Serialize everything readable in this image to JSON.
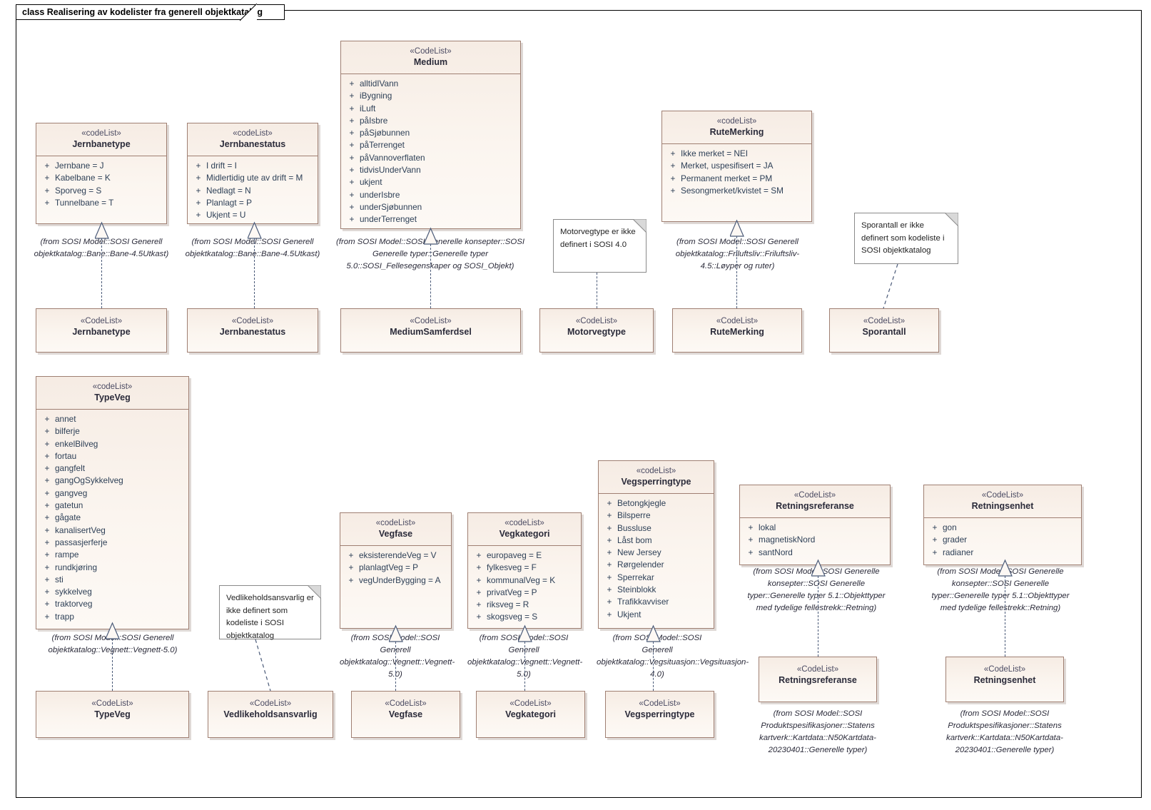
{
  "diagram": {
    "tab_label": "class Realisering av kodelister fra generell objektkatalog",
    "stereotype_codelist_lower": "«codeList»",
    "stereotype_codelist_upper": "«CodeList»"
  },
  "source_classes": {
    "jernbanetype": {
      "stereotype": "«codeList»",
      "name": "Jernbanetype",
      "attributes": [
        {
          "vis": "+",
          "text": "Jernbane = J"
        },
        {
          "vis": "+",
          "text": "Kabelbane = K"
        },
        {
          "vis": "+",
          "text": "Sporveg = S"
        },
        {
          "vis": "+",
          "text": "Tunnelbane = T"
        }
      ],
      "from": "(from SOSI Model::SOSI Generell objektkatalog::Bane::Bane-4.5Utkast)"
    },
    "jernbanestatus": {
      "stereotype": "«codeList»",
      "name": "Jernbanestatus",
      "attributes": [
        {
          "vis": "+",
          "text": "I drift = I"
        },
        {
          "vis": "+",
          "text": "Midlertidig ute av drift = M"
        },
        {
          "vis": "+",
          "text": "Nedlagt = N"
        },
        {
          "vis": "+",
          "text": "Planlagt = P"
        },
        {
          "vis": "+",
          "text": "Ukjent = U"
        }
      ],
      "from": "(from SOSI Model::SOSI Generell objektkatalog::Bane::Bane-4.5Utkast)"
    },
    "medium": {
      "stereotype": "«CodeList»",
      "name": "Medium",
      "attributes": [
        {
          "vis": "+",
          "text": "alltidIVann"
        },
        {
          "vis": "+",
          "text": "iBygning"
        },
        {
          "vis": "+",
          "text": "iLuft"
        },
        {
          "vis": "+",
          "text": "påIsbre"
        },
        {
          "vis": "+",
          "text": "påSjøbunnen"
        },
        {
          "vis": "+",
          "text": "påTerrenget"
        },
        {
          "vis": "+",
          "text": "påVannoverflaten"
        },
        {
          "vis": "+",
          "text": "tidvisUnderVann"
        },
        {
          "vis": "+",
          "text": "ukjent"
        },
        {
          "vis": "+",
          "text": "underIsbre"
        },
        {
          "vis": "+",
          "text": "underSjøbunnen"
        },
        {
          "vis": "+",
          "text": "underTerrenget"
        }
      ],
      "from": "(from SOSI Model::SOSI Generelle konsepter::SOSI Generelle typer::Generelle typer 5.0::SOSI_Fellesegenskaper og SOSI_Objekt)"
    },
    "rutemerking": {
      "stereotype": "«codeList»",
      "name": "RuteMerking",
      "attributes": [
        {
          "vis": "+",
          "text": "Ikke merket = NEI"
        },
        {
          "vis": "+",
          "text": "Merket, uspesifisert = JA"
        },
        {
          "vis": "+",
          "text": "Permanent merket = PM"
        },
        {
          "vis": "+",
          "text": "Sesongmerket/kvistet = SM"
        }
      ],
      "from": "(from SOSI Model::SOSI Generell objektkatalog::Friluftsliv::Friluftsliv-4.5::Løyper og ruter)"
    },
    "typeveg": {
      "stereotype": "«codeList»",
      "name": "TypeVeg",
      "attributes": [
        {
          "vis": "+",
          "text": "annet"
        },
        {
          "vis": "+",
          "text": "bilferje"
        },
        {
          "vis": "+",
          "text": "enkelBilveg"
        },
        {
          "vis": "+",
          "text": "fortau"
        },
        {
          "vis": "+",
          "text": "gangfelt"
        },
        {
          "vis": "+",
          "text": "gangOgSykkelveg"
        },
        {
          "vis": "+",
          "text": "gangveg"
        },
        {
          "vis": "+",
          "text": "gatetun"
        },
        {
          "vis": "+",
          "text": "gågate"
        },
        {
          "vis": "+",
          "text": "kanalisertVeg"
        },
        {
          "vis": "+",
          "text": "passasjerferje"
        },
        {
          "vis": "+",
          "text": "rampe"
        },
        {
          "vis": "+",
          "text": "rundkjøring"
        },
        {
          "vis": "+",
          "text": "sti"
        },
        {
          "vis": "+",
          "text": "sykkelveg"
        },
        {
          "vis": "+",
          "text": "traktorveg"
        },
        {
          "vis": "+",
          "text": "trapp"
        }
      ],
      "from": "(from SOSI Model::SOSI Generell objektkatalog::Vegnett::Vegnett-5.0)"
    },
    "vegfase": {
      "stereotype": "«codeList»",
      "name": "Vegfase",
      "attributes": [
        {
          "vis": "+",
          "text": "eksisterendeVeg = V"
        },
        {
          "vis": "+",
          "text": "planlagtVeg = P"
        },
        {
          "vis": "+",
          "text": "vegUnderBygging = A"
        }
      ],
      "from": "(from SOSI Model::SOSI Generell objektkatalog::Vegnett::Vegnett-5.0)"
    },
    "vegkategori": {
      "stereotype": "«codeList»",
      "name": "Vegkategori",
      "attributes": [
        {
          "vis": "+",
          "text": "europaveg = E"
        },
        {
          "vis": "+",
          "text": "fylkesveg = F"
        },
        {
          "vis": "+",
          "text": "kommunalVeg = K"
        },
        {
          "vis": "+",
          "text": "privatVeg = P"
        },
        {
          "vis": "+",
          "text": "riksveg = R"
        },
        {
          "vis": "+",
          "text": "skogsveg = S"
        }
      ],
      "from": "(from SOSI Model::SOSI Generell objektkatalog::Vegnett::Vegnett-5.0)"
    },
    "vegsperringtype": {
      "stereotype": "«codeList»",
      "name": "Vegsperringtype",
      "attributes": [
        {
          "vis": "+",
          "text": "Betongkjegle"
        },
        {
          "vis": "+",
          "text": "Bilsperre"
        },
        {
          "vis": "+",
          "text": "Bussluse"
        },
        {
          "vis": "+",
          "text": "Låst bom"
        },
        {
          "vis": "+",
          "text": "New Jersey"
        },
        {
          "vis": "+",
          "text": "Rørgelender"
        },
        {
          "vis": "+",
          "text": "Sperrekar"
        },
        {
          "vis": "+",
          "text": "Steinblokk"
        },
        {
          "vis": "+",
          "text": "Trafikkavviser"
        },
        {
          "vis": "+",
          "text": "Ukjent"
        }
      ],
      "from": "(from SOSI Model::SOSI Generell objektkatalog::Vegsituasjon::Vegsituasjon-4.0)"
    },
    "retningsreferanse": {
      "stereotype": "«CodeList»",
      "name": "Retningsreferanse",
      "attributes": [
        {
          "vis": "+",
          "text": "lokal"
        },
        {
          "vis": "+",
          "text": "magnetiskNord"
        },
        {
          "vis": "+",
          "text": "santNord"
        }
      ],
      "from": "(from SOSI Model::SOSI Generelle konsepter::SOSI Generelle typer::Generelle typer 5.1::Objekttyper med tydelige fellestrekk::Retning)"
    },
    "retningsenhet": {
      "stereotype": "«CodeList»",
      "name": "Retningsenhet",
      "attributes": [
        {
          "vis": "+",
          "text": "gon"
        },
        {
          "vis": "+",
          "text": "grader"
        },
        {
          "vis": "+",
          "text": "radianer"
        }
      ],
      "from": "(from SOSI Model::SOSI Generelle konsepter::SOSI Generelle typer::Generelle typer 5.1::Objekttyper med tydelige fellestrekk::Retning)"
    }
  },
  "target_classes": {
    "jernbanetype": {
      "stereotype": "«CodeList»",
      "name": "Jernbanetype"
    },
    "jernbanestatus": {
      "stereotype": "«CodeList»",
      "name": "Jernbanestatus"
    },
    "mediumsamferdsel": {
      "stereotype": "«CodeList»",
      "name": "MediumSamferdsel"
    },
    "motorvegtype": {
      "stereotype": "«CodeList»",
      "name": "Motorvegtype"
    },
    "rutemerking": {
      "stereotype": "«CodeList»",
      "name": "RuteMerking"
    },
    "sporantall": {
      "stereotype": "«CodeList»",
      "name": "Sporantall"
    },
    "typeveg": {
      "stereotype": "«CodeList»",
      "name": "TypeVeg"
    },
    "vedlikeholdsansvarlig": {
      "stereotype": "«CodeList»",
      "name": "Vedlikeholdsansvarlig"
    },
    "vegfase": {
      "stereotype": "«CodeList»",
      "name": "Vegfase"
    },
    "vegkategori": {
      "stereotype": "«CodeList»",
      "name": "Vegkategori"
    },
    "vegsperringtype": {
      "stereotype": "«CodeList»",
      "name": "Vegsperringtype"
    },
    "retningsreferanse": {
      "stereotype": "«CodeList»",
      "name": "Retningsreferanse",
      "from": "(from SOSI Model::SOSI Produktspesifikasjoner::Statens kartverk::Kartdata::N50Kartdata-20230401::Generelle typer)"
    },
    "retningsenhet": {
      "stereotype": "«CodeList»",
      "name": "Retningsenhet",
      "from": "(from SOSI Model::SOSI Produktspesifikasjoner::Statens kartverk::Kartdata::N50Kartdata-20230401::Generelle typer)"
    }
  },
  "notes": {
    "motorvegtype": "Motorvegtype er ikke definert i SOSI 4.0",
    "sporantall": "Sporantall er ikke definert som kodeliste i SOSI objektkatalog",
    "vedlikeholdsansvarlig": "Vedlikeholdsansvarlig er ikke definert som kodeliste i SOSI objektkatalog"
  }
}
